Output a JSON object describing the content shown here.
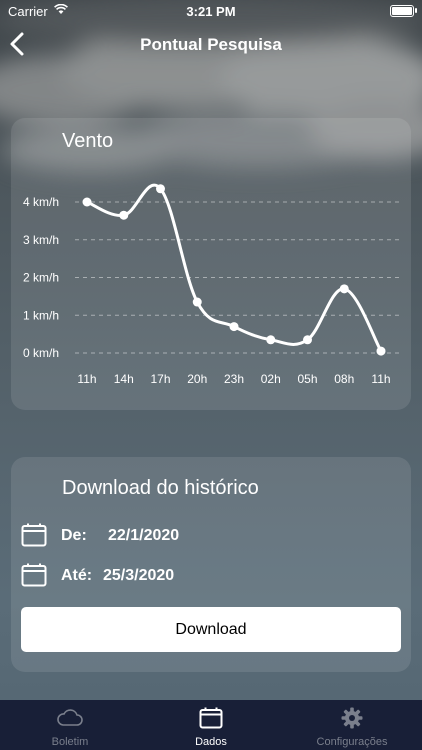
{
  "status_bar": {
    "carrier": "Carrier",
    "time": "3:21 PM"
  },
  "navbar": {
    "title": "Pontual Pesquisa",
    "back_icon": "chevron-left-icon"
  },
  "chart_card": {
    "title": "Vento"
  },
  "chart_data": {
    "type": "line",
    "title": "Vento",
    "categories": [
      "11h",
      "14h",
      "17h",
      "20h",
      "23h",
      "02h",
      "05h",
      "08h",
      "11h"
    ],
    "y_ticks": [
      "0 km/h",
      "1 km/h",
      "2 km/h",
      "3 km/h",
      "4 km/h"
    ],
    "ylim": [
      0,
      4
    ],
    "grid": true,
    "values": [
      4.0,
      3.65,
      4.35,
      1.35,
      0.7,
      0.35,
      0.35,
      1.7,
      0.05
    ],
    "color": "#ffffff"
  },
  "download_card": {
    "title": "Download do histórico",
    "from_label": "De:",
    "from_value": "22/1/2020",
    "to_label": "Até:",
    "to_value": "25/3/2020",
    "button_label": "Download",
    "calendar_icon": "calendar-icon"
  },
  "tabbar": {
    "background": "#181f37",
    "items": [
      {
        "label": "Boletim",
        "icon": "cloud-icon",
        "active": false
      },
      {
        "label": "Dados",
        "icon": "calendar-icon",
        "active": true
      },
      {
        "label": "Configurações",
        "icon": "gear-icon",
        "active": false
      }
    ],
    "active_color": "#ffffff",
    "inactive_color": "#7a7f8c"
  }
}
